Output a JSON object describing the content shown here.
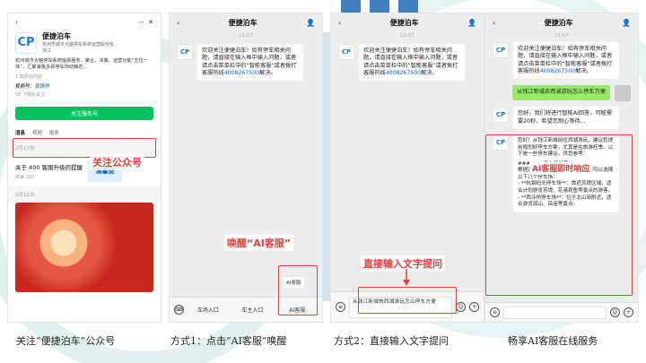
{
  "colors": {
    "accent_red": "#e0413a",
    "wechat_green": "#07c160",
    "bubble_green": "#95ec69",
    "brand_blue": "#1a7ccf",
    "link_blue": "#2a62b8"
  },
  "p1": {
    "more": "···",
    "close": "✕",
    "name": "便捷泊车",
    "company": "杭州市城市大脑停车系统运营股份有...",
    "location": "浙江",
    "desc": "杭州城市大脑停车系统指挥服务、聚合、决策、运营功能“五位一体”，汇聚海量多源停车场动静态...",
    "badge": "1 篇原创内容",
    "video_label": "视频号：",
    "video_name": "泉蹟停",
    "friends": "58 个朋友关注",
    "follow_btn": "关注服务号",
    "tabs": [
      "消息",
      "视频",
      "服务"
    ],
    "date1": "2月17日",
    "article_title": "关于 400 客服升级的提醒",
    "article_reads": "阅读 202",
    "thumb_text": "温馨提",
    "date2": "2月12日"
  },
  "p2": {
    "title": "便捷泊车",
    "time": "11:07",
    "welcome": "欢迎关注便捷泊车！如有停车相关问题，请直接在输入框中输入问题，或者请点击菜单栏中的“智能客服”或者拨打客服热线",
    "phone": "4008267500",
    "tail": "解决。",
    "menu1": "AI客服",
    "menu2": "AI客服",
    "bar": [
      "车场入口",
      "车主入口",
      "AI客服"
    ]
  },
  "p3": {
    "title": "便捷泊车",
    "time": "11:07",
    "welcome": "欢迎关注便捷泊车！如有停车相关问题，请直接在输入框中输入问题，或者请点击菜单栏中的“智能客服”或者拨打客服热线",
    "phone": "4008267500",
    "tail": "解决。",
    "input_text": "从钱江新城去西湖游玩怎么停车方便"
  },
  "p4": {
    "title": "便捷泊车",
    "time": "11:07",
    "welcome": "欢迎关注便捷泊车！如有停车相关问题，请直接在输入框中输入问题，或者请点击菜单栏中的“智能客服”或者拨打客服热线",
    "phone": "4008267500",
    "tail": "解决。",
    "user_msg": "从钱江新城去西湖游玩怎么停车方便",
    "ai1": "您好，我们将进行智能AI回答，可能需要20秒，希望您耐心等待...",
    "ai2": "您好！从钱江新城前往西湖游玩，建议您提前规划好停车方案，尤其是在旅游旺季。以下是一些停车建议，供您参考：",
    "ai3": "### **1. 停车场推荐**\n根据西湖景区的停车资源分布，您可以选择以下几个停车场：\n- **杭钢码头停车场**：靠近苏堤区域，适合计划游览苏堤、花港观鱼等景点的游客。\n- **西泠桥停车场**：位于北山街附近，适合游览孤山、岳庙等景点。"
  },
  "labels": {
    "follow": "关注公众号",
    "wake": "唤醒“AI客服”",
    "direct": "直接输入文字提问",
    "instant": "AI客服即时响应"
  },
  "captions": {
    "c1": "关注“便捷泊车”公众号",
    "c2": "方式1：点击“AI客服”唤醒",
    "c3": "方式2：直接输入文字提问",
    "c4": "畅享AI客服在线服务"
  }
}
